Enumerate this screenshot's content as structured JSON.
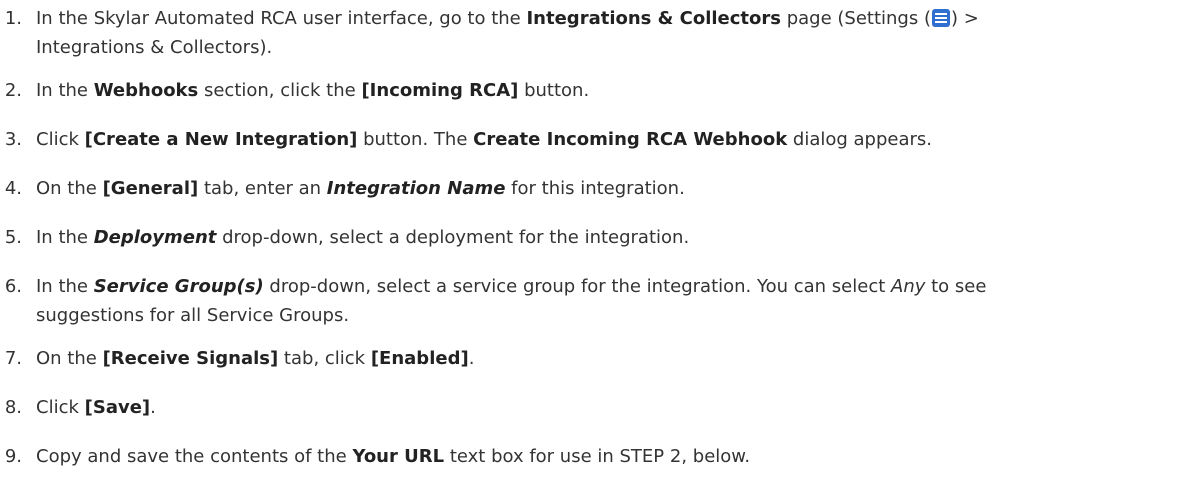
{
  "steps": [
    {
      "number": "1.",
      "t1": "In the Skylar Automated RCA user interface, go to the ",
      "b1": "Integrations & Collectors",
      "t2": " page (Settings (",
      "icon": "settings-menu-icon",
      "t3": ") >",
      "line2": "Integrations & Collectors)."
    },
    {
      "number": "2.",
      "t1": "In the ",
      "b1": "Webhooks",
      "t2": " section, click the ",
      "b2": "[Incoming RCA]",
      "t3": " button."
    },
    {
      "number": "3.",
      "t1": "Click ",
      "b1": "[Create a New Integration]",
      "t2": " button. The ",
      "b2": "Create Incoming RCA Webhook",
      "t3": " dialog appears."
    },
    {
      "number": "4.",
      "t1": "On the ",
      "b1": "[General]",
      "t2": " tab, enter an ",
      "b2": "Integration Name",
      "t3": " for this integration."
    },
    {
      "number": "5.",
      "t1": "In the ",
      "b1": "Deployment",
      "t2": " drop-down, select a deployment for the integration."
    },
    {
      "number": "6.",
      "t1": "In the ",
      "b1": "Service Group(s)",
      "t2": " drop-down, select a service group for the integration. You can select ",
      "i1": "Any",
      "t3": " to see",
      "line2": "suggestions for all Service Groups."
    },
    {
      "number": "7.",
      "t1": "On the ",
      "b1": "[Receive Signals]",
      "t2": " tab, click ",
      "b2": "[Enabled]",
      "t3": "."
    },
    {
      "number": "8.",
      "t1": "Click ",
      "b1": "[Save]",
      "t2": "."
    },
    {
      "number": "9.",
      "t1": "Copy and save the contents of the ",
      "b1": "Your URL",
      "t2": " text box for use in STEP 2, below."
    }
  ],
  "colors": {
    "text": "#333333",
    "icon": "#2f6fd0"
  }
}
